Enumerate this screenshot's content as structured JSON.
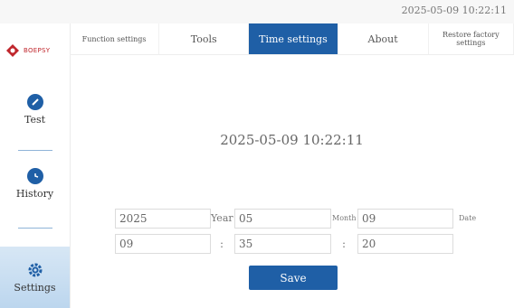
{
  "status_bar": {
    "datetime": "2025-05-09 10:22:11"
  },
  "logo": {
    "brand": "BOEPSY"
  },
  "sidebar": {
    "items": [
      {
        "label": "Test",
        "icon": "pencil-icon"
      },
      {
        "label": "History",
        "icon": "clock-icon"
      },
      {
        "label": "Settings",
        "icon": "gear-icon"
      }
    ],
    "active": "Settings"
  },
  "tabs": [
    {
      "label": "Function settings"
    },
    {
      "label": "Tools"
    },
    {
      "label": "Time settings"
    },
    {
      "label": "About"
    },
    {
      "label": "Restore factory settings"
    }
  ],
  "active_tab": "Time settings",
  "time_panel": {
    "display": "2025-05-09 10:22:11",
    "year_value": "2025",
    "year_label": "Year",
    "month_value": "05",
    "month_label": "Month",
    "date_value": "09",
    "date_label": "Date",
    "hour_value": "09",
    "minute_value": "35",
    "second_value": "20",
    "separator": ":",
    "save_label": "Save"
  },
  "colors": {
    "accent": "#1f5fa6",
    "brand_red": "#c0272d"
  }
}
